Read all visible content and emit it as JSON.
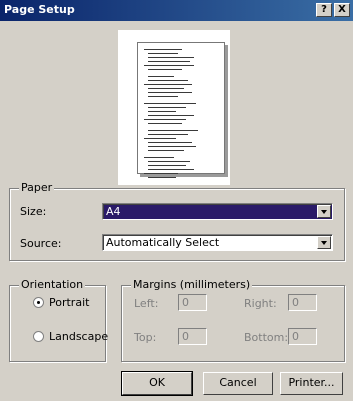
{
  "window": {
    "title": "Page Setup",
    "help_label": "?",
    "close_label": "X"
  },
  "paper": {
    "legend": "Paper",
    "size_label": "Size:",
    "size_value": "A4",
    "source_label": "Source:",
    "source_value": "Automatically Select"
  },
  "orientation": {
    "legend": "Orientation",
    "portrait_label": "Portrait",
    "landscape_label": "Landscape",
    "selected": "Portrait"
  },
  "margins": {
    "legend": "Margins (millimeters)",
    "left_label": "Left:",
    "left_value": "0",
    "right_label": "Right:",
    "right_value": "0",
    "top_label": "Top:",
    "top_value": "0",
    "bottom_label": "Bottom:",
    "bottom_value": "0"
  },
  "buttons": {
    "ok": "OK",
    "cancel": "Cancel",
    "printer": "Printer..."
  }
}
